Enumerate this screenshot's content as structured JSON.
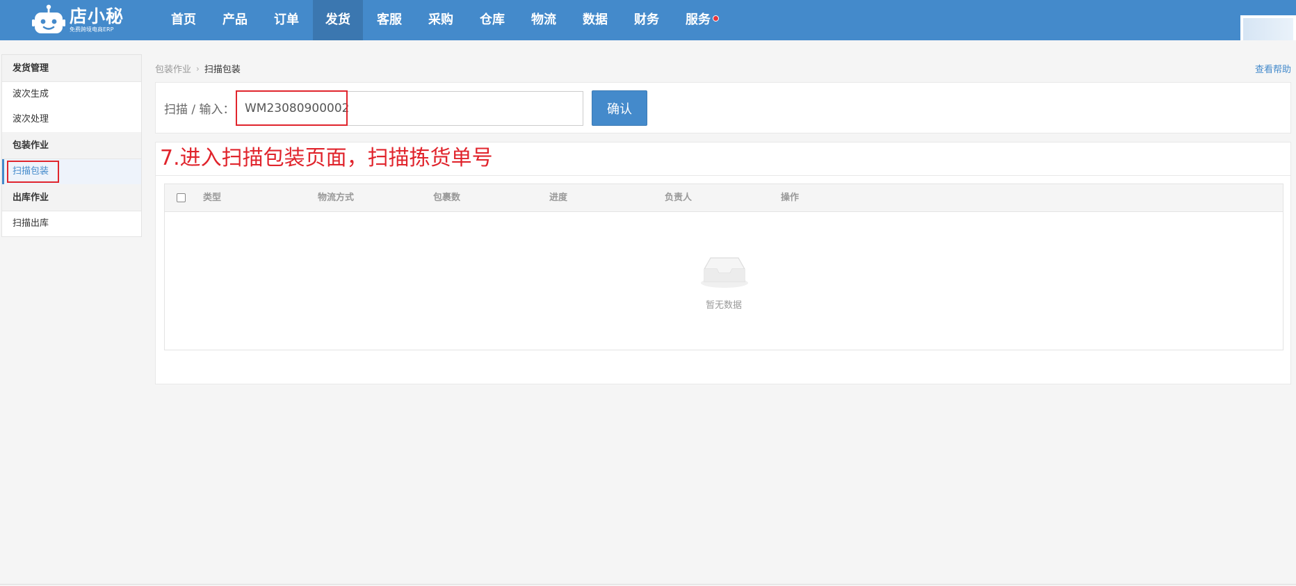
{
  "brand": {
    "name": "店小秘",
    "tagline": "免费跨境电商ERP"
  },
  "nav": {
    "items": [
      {
        "label": "首页"
      },
      {
        "label": "产品"
      },
      {
        "label": "订单"
      },
      {
        "label": "发货"
      },
      {
        "label": "客服"
      },
      {
        "label": "采购"
      },
      {
        "label": "仓库"
      },
      {
        "label": "物流"
      },
      {
        "label": "数据"
      },
      {
        "label": "财务"
      },
      {
        "label": "服务"
      }
    ],
    "active": "发货"
  },
  "sidebar": {
    "groups": [
      {
        "title": "发货管理",
        "items": [
          "波次生成",
          "波次处理"
        ]
      },
      {
        "title": "包装作业",
        "items": [
          "扫描包装"
        ]
      },
      {
        "title": "出库作业",
        "items": [
          "扫描出库"
        ]
      }
    ],
    "active_item": "扫描包装"
  },
  "breadcrumb": {
    "parent": "包装作业",
    "current": "扫描包装"
  },
  "help_link": "查看帮助",
  "scan": {
    "label": "扫描 / 输入：",
    "value": "WM23080900002",
    "confirm_label": "确认"
  },
  "annotation": "7.进入扫描包装页面，扫描拣货单号",
  "table": {
    "columns": [
      "类型",
      "物流方式",
      "包裹数",
      "进度",
      "负责人",
      "操作"
    ],
    "empty_text": "暂无数据"
  },
  "colors": {
    "primary": "#448acb",
    "nav_active": "#3b77b0",
    "highlight_red": "#e0242c",
    "badge_red": "#e8363c"
  }
}
